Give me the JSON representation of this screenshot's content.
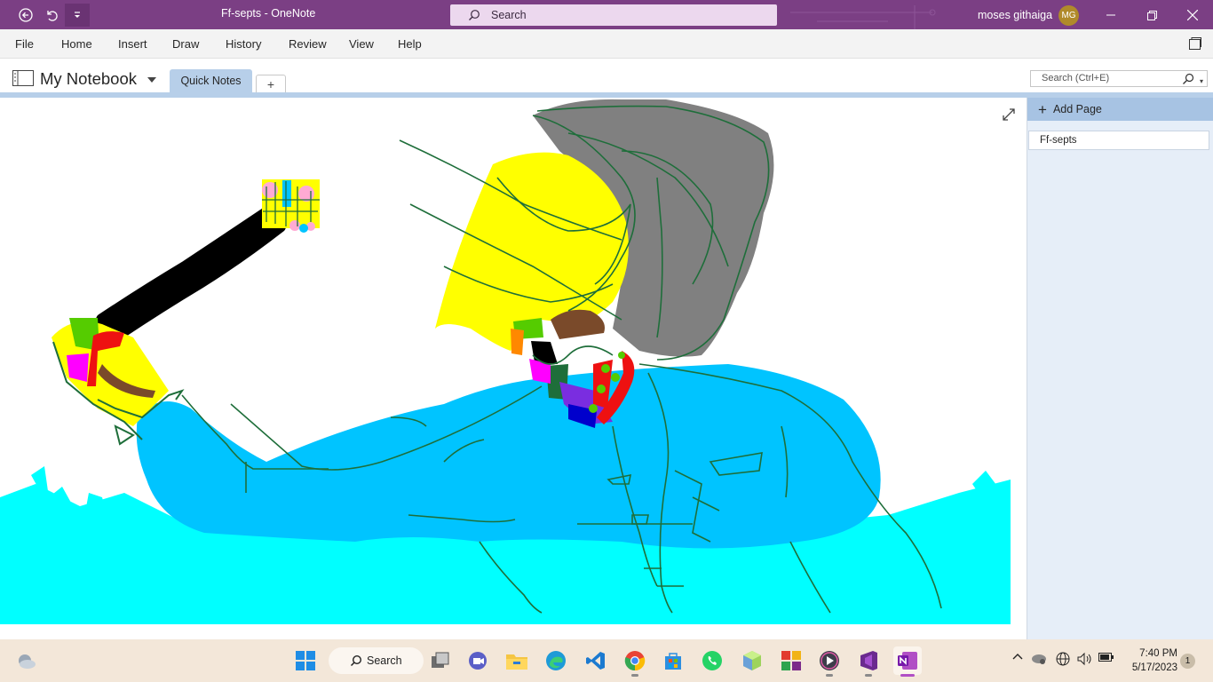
{
  "window": {
    "title": "Ff-septs  -  OneNote",
    "search_placeholder": "Search",
    "user_name": "moses githaiga",
    "user_initials": "MG"
  },
  "menu": {
    "items": [
      "File",
      "Home",
      "Insert",
      "Draw",
      "History",
      "Review",
      "View",
      "Help"
    ]
  },
  "notebook": {
    "name": "My Notebook",
    "section_tab": "Quick Notes",
    "add_section_label": "+",
    "search_placeholder": "Search (Ctrl+E)"
  },
  "pages": {
    "add_label": "Add Page",
    "items": [
      "Ff-septs"
    ]
  },
  "taskbar": {
    "search_label": "Search",
    "time": "7:40 PM",
    "date": "5/17/2023",
    "notification_count": "1",
    "apps": [
      "start-icon",
      "search-icon",
      "task-view-icon",
      "teams-icon",
      "file-explorer-icon",
      "edge-icon",
      "vscode-icon",
      "chrome-icon",
      "store-icon",
      "whatsapp-icon",
      "cube-app-icon",
      "grid-app-icon",
      "media-player-icon",
      "visual-studio-icon",
      "onenote-icon"
    ]
  },
  "colors": {
    "titlebar": "#7b3f84",
    "accent_tab": "#b7cfe9",
    "taskbar": "#f3e7d9"
  }
}
